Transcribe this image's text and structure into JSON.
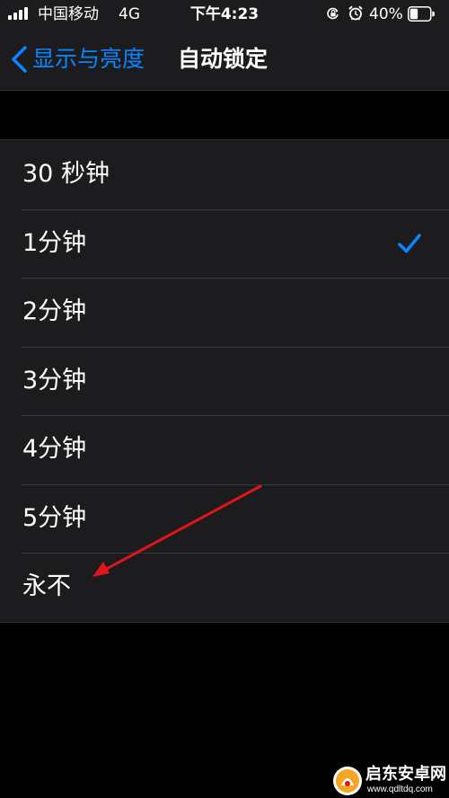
{
  "status_bar": {
    "carrier": "中国移动",
    "network": "4G",
    "time": "下午4:23",
    "battery_percent": "40%",
    "battery_level": 0.4,
    "icons": [
      "signal-icon",
      "orientation-lock-icon",
      "alarm-icon",
      "battery-icon"
    ]
  },
  "nav": {
    "back_label": "显示与亮度",
    "title": "自动锁定"
  },
  "options": [
    {
      "label": "30 秒钟",
      "selected": false
    },
    {
      "label": "1分钟",
      "selected": true
    },
    {
      "label": "2分钟",
      "selected": false
    },
    {
      "label": "3分钟",
      "selected": false
    },
    {
      "label": "4分钟",
      "selected": false
    },
    {
      "label": "5分钟",
      "selected": false
    },
    {
      "label": "永不",
      "selected": false
    }
  ],
  "colors": {
    "accent": "#0a84ff",
    "background": "#000000",
    "cell": "#1c1c1e",
    "annotation": "#e0141b"
  },
  "watermark": {
    "name": "启东安卓网",
    "url": "www.qdltdq.com"
  }
}
